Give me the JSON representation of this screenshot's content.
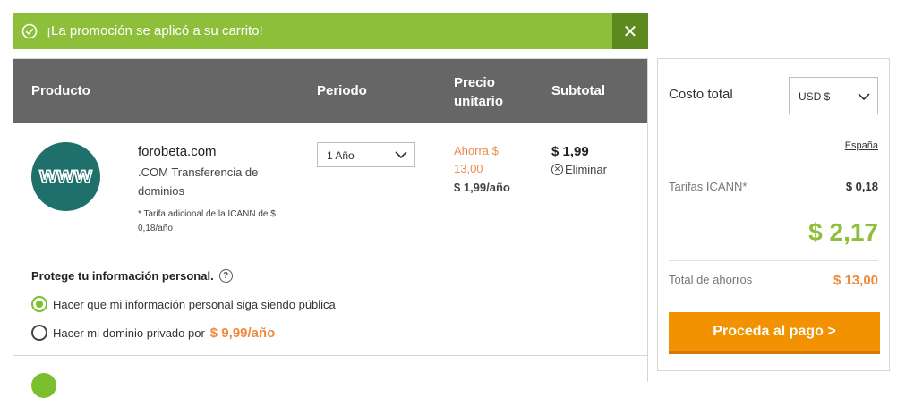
{
  "promo": {
    "message": "¡La promoción se aplicó a su carrito!",
    "close_symbol": "✕"
  },
  "table": {
    "headers": {
      "product": "Producto",
      "period": "Periodo",
      "unit_price": "Precio unitario",
      "subtotal": "Subtotal"
    }
  },
  "item": {
    "icon_text": "www",
    "domain": "forobeta.com",
    "description": ".COM Transferencia de dominios",
    "note": "* Tarifa adicional de la ICANN de $ 0,18/año",
    "period_selected": "1 Año",
    "savings": "Ahorra $ 13,00",
    "unit_price": "$ 1,99/año",
    "subtotal": "$ 1,99",
    "remove_label": "Eliminar"
  },
  "privacy": {
    "title": "Protege tu información personal.",
    "help_symbol": "?",
    "option_public": "Hacer que mi información personal siga siendo pública",
    "option_private_prefix": "Hacer mi dominio privado por",
    "option_private_price": "$ 9,99/año",
    "selected": "public"
  },
  "summary": {
    "cost_label": "Costo total",
    "currency_selected": "USD $",
    "country_link": "España",
    "icann_label": "Tarifas ICANN*",
    "icann_value": "$ 0,18",
    "total": "$ 2,17",
    "savings_label": "Total de ahorros",
    "savings_value": "$ 13,00",
    "pay_button": "Proceda al pago >"
  },
  "colors": {
    "promo_green": "#8dbf3a",
    "header_gray": "#666666",
    "accent_orange": "#f39200",
    "savings_orange": "#f08a3c",
    "www_teal": "#1f6f6b"
  }
}
